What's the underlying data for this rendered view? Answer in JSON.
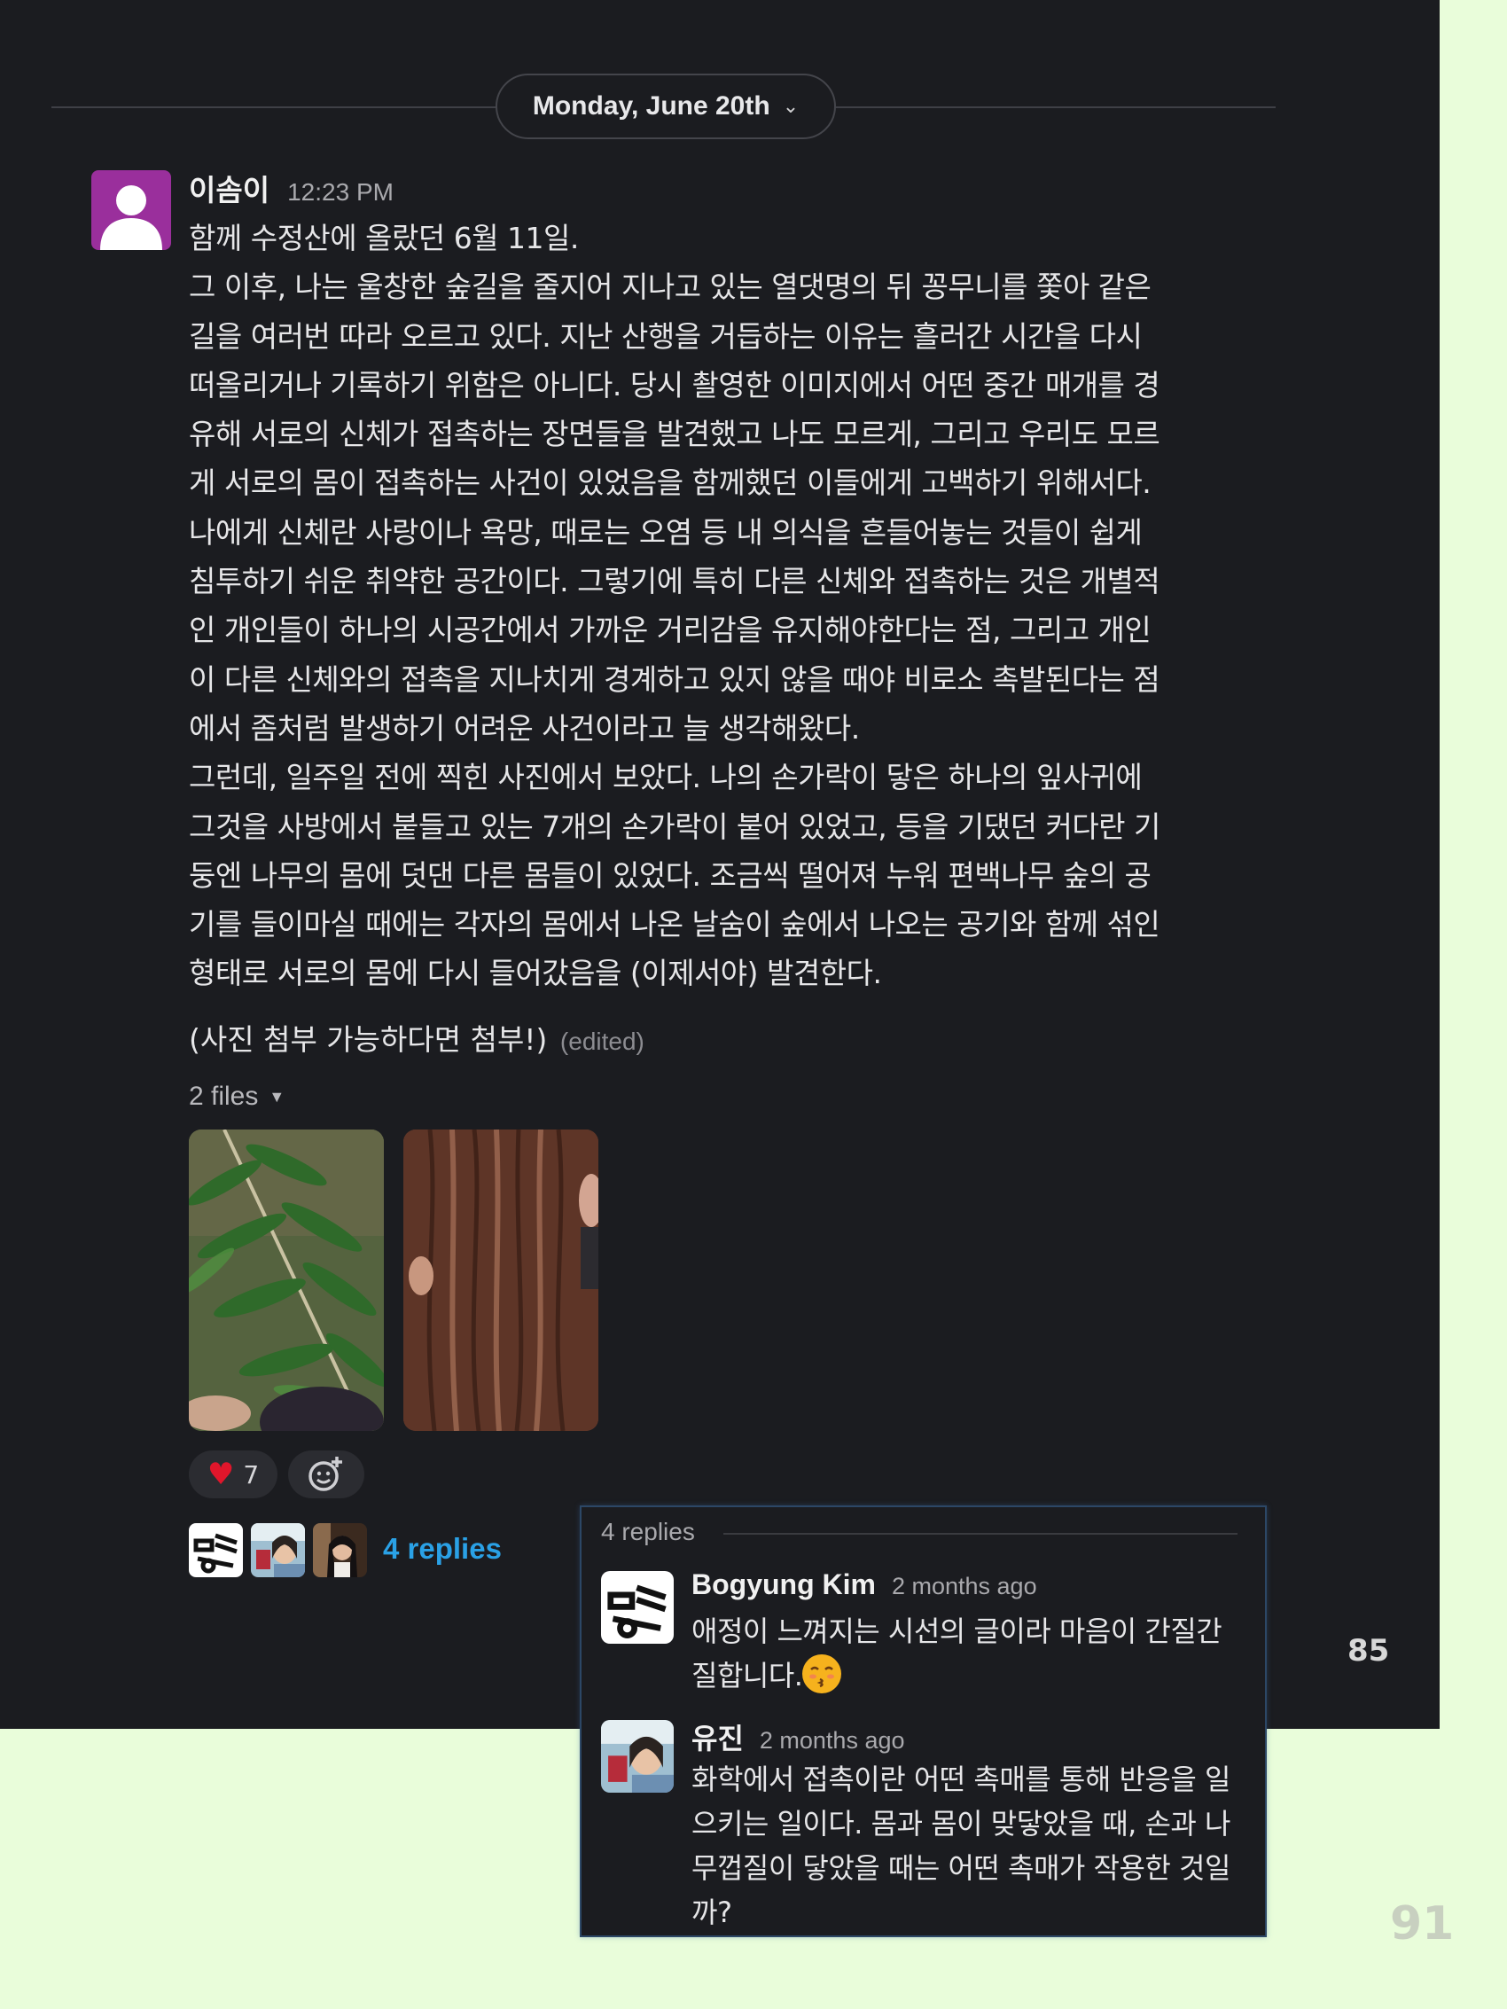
{
  "date_divider": {
    "label": "Monday, June 20th"
  },
  "message": {
    "author": "이솜이",
    "time": "12:23 PM",
    "lines": [
      "함께 수정산에 올랐던 6월 11일.",
      "그 이후, 나는 울창한 숲길을 줄지어 지나고 있는 열댓명의  뒤 꽁무니를 쫓아 같은",
      "길을 여러번 따라 오르고 있다. 지난 산행을 거듭하는 이유는 흘러간 시간을 다시",
      "떠올리거나 기록하기 위함은 아니다. 당시 촬영한 이미지에서 어떤 중간 매개를 경",
      "유해 서로의 신체가 접촉하는 장면들을 발견했고 나도 모르게, 그리고 우리도 모르",
      "게 서로의 몸이 접촉하는 사건이 있었음을 함께했던 이들에게 고백하기 위해서다.",
      "나에게 신체란 사랑이나 욕망, 때로는 오염 등 내 의식을 흔들어놓는 것들이 쉽게",
      "침투하기 쉬운 취약한 공간이다. 그렇기에 특히 다른 신체와 접촉하는 것은 개별적",
      "인 개인들이 하나의 시공간에서 가까운 거리감을 유지해야한다는 점, 그리고 개인",
      "이 다른 신체와의 접촉을 지나치게 경계하고 있지 않을 때야 비로소 촉발된다는 점",
      "에서 좀처럼 발생하기 어려운 사건이라고 늘 생각해왔다.",
      "그런데, 일주일 전에 찍힌 사진에서 보았다. 나의 손가락이 닿은 하나의 잎사귀에",
      "그것을 사방에서 붙들고 있는 7개의 손가락이 붙어 있었고, 등을 기댔던 커다란 기",
      "둥엔 나무의 몸에 덧댄  다른 몸들이 있었다. 조금씩 떨어져 누워 편백나무 숲의 공",
      "기를 들이마실 때에는 각자의 몸에서 나온 날숨이 숲에서 나오는 공기와 함께 섞인",
      "형태로 서로의 몸에 다시 들어갔음을 (이제서야) 발견한다."
    ],
    "attachment_note": "(사진 첨부 가능하다면 첨부!)",
    "edited_label": "(edited)",
    "files_label": "2 files",
    "photos": [
      "leaf-photo",
      "tree-bark-photo"
    ],
    "reaction": {
      "emoji": "heart",
      "count": "7"
    },
    "reply_count_label": "4 replies"
  },
  "thread": {
    "header": "4 replies",
    "replies": [
      {
        "author": "Bogyung Kim",
        "ago": "2 months ago",
        "lines": [
          "애정이 느껴지는 시선의 글이라 마음이 간질간",
          "질합니다."
        ],
        "emoji": "kissing-face"
      },
      {
        "author": "유진",
        "ago": "2 months ago",
        "lines": [
          "화학에서 접촉이란 어떤 촉매를 통해 반응을 일",
          "으키는 일이다. 몸과 몸이 맞닿았을 때, 손과 나",
          "무껍질이 닿았을 때는 어떤 촉매가 작용한 것일",
          "까?"
        ]
      }
    ]
  },
  "page_numbers": {
    "left_page": "85",
    "right_page": "91"
  },
  "colors": {
    "panel": "#1b1c20",
    "page_background": "#e9fdda",
    "link": "#2aa1e6",
    "avatar": "#9a2f9c",
    "heart": "#e0162b"
  }
}
